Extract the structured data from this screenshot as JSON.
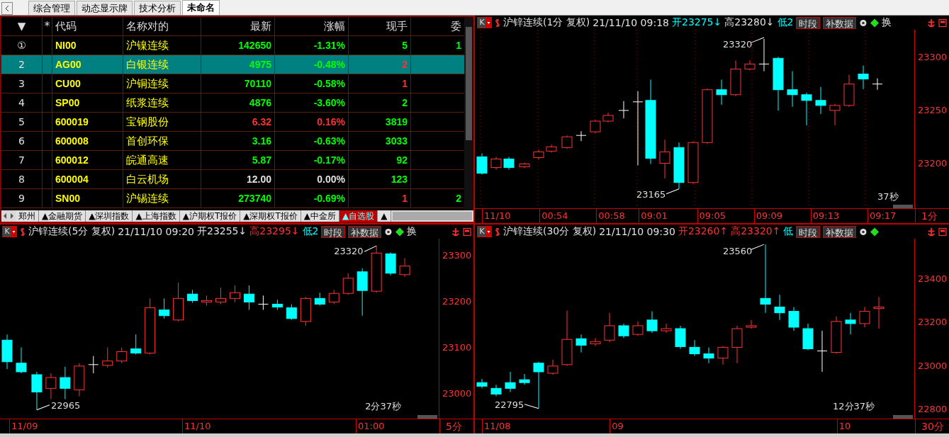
{
  "top_tabs": [
    {
      "label": "综合管理",
      "selected": false
    },
    {
      "label": "动态显示牌",
      "selected": false
    },
    {
      "label": "技术分析",
      "selected": false
    },
    {
      "label": "未命名",
      "selected": true
    }
  ],
  "table": {
    "columns": [
      "▼",
      "*",
      "代码",
      "名称对的",
      "最新",
      "涨幅",
      "现手",
      "委"
    ],
    "rows": [
      {
        "index": "①",
        "code": "NI00",
        "name": "沪镍连续",
        "last": {
          "text": "142650",
          "color": "#00ff00"
        },
        "change": {
          "text": "-1.31%",
          "color": "#00ff00"
        },
        "volume": {
          "text": "5",
          "color": "#00ff00"
        },
        "column_8": "1",
        "selected": false
      },
      {
        "index": "2",
        "code": "AG00",
        "name": "白银连续",
        "last": {
          "text": "4975",
          "color": "#00ff00"
        },
        "change": {
          "text": "-0.48%",
          "color": "#00ff00"
        },
        "volume": {
          "text": "2",
          "color": "#ff3232"
        },
        "selected": true
      },
      {
        "index": "3",
        "code": "CU00",
        "name": "沪铜连续",
        "last": {
          "text": "70110",
          "color": "#00ff00"
        },
        "change": {
          "text": "-0.58%",
          "color": "#00ff00"
        },
        "volume": {
          "text": "1",
          "color": "#ff3232"
        },
        "selected": false
      },
      {
        "index": "4",
        "code": "SP00",
        "name": "纸浆连续",
        "last": {
          "text": "4876",
          "color": "#00ff00"
        },
        "change": {
          "text": "-3.60%",
          "color": "#00ff00"
        },
        "volume": {
          "text": "2",
          "color": "#00ff00"
        },
        "selected": false
      },
      {
        "index": "5",
        "code": "600019",
        "name": "宝钢股份",
        "last": {
          "text": "6.32",
          "color": "#ff3232"
        },
        "change": {
          "text": "0.16%",
          "color": "#ff3232"
        },
        "volume": {
          "text": "3819",
          "color": "#00ff00"
        },
        "selected": false
      },
      {
        "index": "6",
        "code": "600008",
        "name": "首创环保",
        "last": {
          "text": "3.16",
          "color": "#00ff00"
        },
        "change": {
          "text": "-0.63%",
          "color": "#00ff00"
        },
        "volume": {
          "text": "3033",
          "color": "#00ff00"
        },
        "selected": false
      },
      {
        "index": "7",
        "code": "600012",
        "name": "皖通高速",
        "last": {
          "text": "5.87",
          "color": "#00ff00"
        },
        "change": {
          "text": "-0.17%",
          "color": "#00ff00"
        },
        "volume": {
          "text": "92",
          "color": "#00ff00"
        },
        "selected": false
      },
      {
        "index": "8",
        "code": "600004",
        "name": "白云机场",
        "last": {
          "text": "12.00",
          "color": "#e0e0e0"
        },
        "change": {
          "text": "0.00%",
          "color": "#e0e0e0"
        },
        "volume": {
          "text": "123",
          "color": "#00ff00"
        },
        "selected": false
      },
      {
        "index": "9",
        "code": "SN00",
        "name": "沪锡连续",
        "last": {
          "text": "273740",
          "color": "#00ff00"
        },
        "change": {
          "text": "-0.69%",
          "color": "#00ff00"
        },
        "volume": {
          "text": "1",
          "color": "#ff3232"
        },
        "column_8": "2",
        "selected": false
      }
    ]
  },
  "sheet_tabs": [
    {
      "label": "郑州",
      "selected": false
    },
    {
      "label": "▲金融期货",
      "selected": false
    },
    {
      "label": "▲深圳指数",
      "selected": false
    },
    {
      "label": "▲上海指数",
      "selected": false
    },
    {
      "label": "▲沪期权T报价",
      "selected": false
    },
    {
      "label": "▲深期权T报价",
      "selected": false
    },
    {
      "label": "▲中金所",
      "selected": false
    },
    {
      "label": "▲自选股",
      "selected": true
    },
    {
      "label": "▲",
      "selected": false
    }
  ],
  "charts": [
    {
      "k_label": "K",
      "header": [
        {
          "text": "沪锌连续(1分 复权)",
          "color": "#e0e0e0"
        },
        {
          "text": "21/11/10 09:18",
          "color": "#e0e0e0"
        },
        {
          "text": "开23275↓",
          "color": "#00ffff"
        },
        {
          "text": "高23280↓",
          "color": "#e0e0e0"
        },
        {
          "text": "低2",
          "color": "#00ffff"
        }
      ],
      "buttons": [
        "时段",
        "补数据"
      ],
      "tail": "换",
      "yticks": [
        "23300",
        "23250",
        "23200"
      ],
      "xlabels": [
        "11/10",
        "00:54",
        "00:58",
        "09:01",
        "09:05",
        "09:09",
        "09:13",
        "09:17"
      ],
      "period": "1分",
      "annotations": [
        "23320",
        "23165",
        "37秒"
      ]
    },
    {
      "k_label": "K",
      "header": [
        {
          "text": "沪锌连续(5分 复权)",
          "color": "#e0e0e0"
        },
        {
          "text": "21/11/10 09:20",
          "color": "#e0e0e0"
        },
        {
          "text": "开23255↓",
          "color": "#e0e0e0"
        },
        {
          "text": "高23295↓",
          "color": "#ff3232"
        },
        {
          "text": "低2",
          "color": "#00ffff"
        }
      ],
      "buttons": [
        "时段",
        "补数据"
      ],
      "tail": "换",
      "yticks": [
        "23300",
        "23200",
        "23100",
        "23000"
      ],
      "xlabels": [
        "11/09",
        "11/10",
        "01:00"
      ],
      "period": "5分",
      "annotations": [
        "23320",
        "22965",
        "2分37秒"
      ]
    },
    {
      "k_label": "K",
      "header": [
        {
          "text": "沪锌连续(30分 复权)",
          "color": "#e0e0e0"
        },
        {
          "text": "21/11/10 09:30",
          "color": "#e0e0e0"
        },
        {
          "text": "开23260↑",
          "color": "#ff3232"
        },
        {
          "text": "高23320↑",
          "color": "#ff3232"
        },
        {
          "text": "低",
          "color": "#00ffff"
        }
      ],
      "buttons": [
        "时段",
        "补数据"
      ],
      "yticks": [
        "23400",
        "23200",
        "23000",
        "22800"
      ],
      "xlabels": [
        "11/08",
        "09",
        "10"
      ],
      "period": "30分",
      "annotations": [
        "23560",
        "22795",
        "12分37秒"
      ]
    }
  ]
}
